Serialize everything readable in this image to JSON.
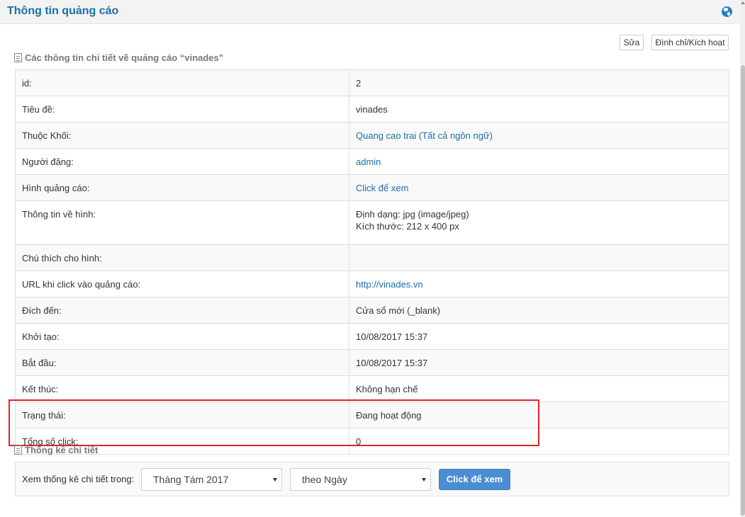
{
  "header": {
    "title": "Thông tin quảng cáo",
    "icon": "globe-icon"
  },
  "toolbar": {
    "edit_label": "Sửa",
    "suspend_label": "Đình chỉ/Kích hoạt"
  },
  "details": {
    "caption": "Các thông tin chi tiết về quảng cáo “vinades”",
    "rows": [
      {
        "label": "id:",
        "value": "2"
      },
      {
        "label": "Tiêu đề:",
        "value": "vinades"
      },
      {
        "label": "Thuộc Khối:",
        "value": "Quang cao trai (Tất cả ngôn ngữ)"
      },
      {
        "label": "Người đăng:",
        "value": "admin"
      },
      {
        "label": "Hình quảng cáo:",
        "value": "Click để xem"
      },
      {
        "label": "Thông tin về hình:",
        "value": "Định dạng: jpg (image/jpeg)",
        "value2": "Kích thước: 212 x 400 px"
      },
      {
        "label": "Chú thích cho hình:",
        "value": ""
      },
      {
        "label": "URL khi click vào quảng cáo:",
        "value": "http://vinades.vn"
      },
      {
        "label": "Đích đến:",
        "value": "Cửa sổ mới (_blank)"
      },
      {
        "label": "Khởi tạo:",
        "value": "10/08/2017 15:37"
      },
      {
        "label": "Bắt đầu:",
        "value": "10/08/2017 15:37"
      },
      {
        "label": "Kết thúc:",
        "value": "Không hạn chế"
      },
      {
        "label": "Trạng thái:",
        "value": "Đang hoạt động"
      },
      {
        "label": "Tổng số click:",
        "value": "0"
      }
    ]
  },
  "stats": {
    "caption": "Thống kê chi tiết",
    "filter_label": "Xem thống kê chi tiết trong:",
    "month_selected": "Tháng Tám 2017",
    "unit_selected": "theo Ngày",
    "view_button": "Click để xem"
  },
  "colors": {
    "accent": "#1a6fa6",
    "button": "#4a8ed1",
    "highlight": "#d9262c"
  }
}
